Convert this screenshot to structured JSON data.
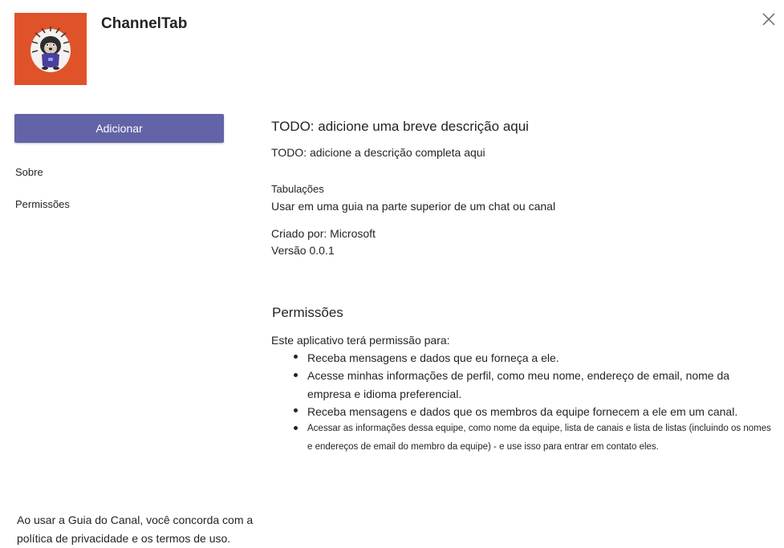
{
  "app": {
    "name": "ChannelTab",
    "add_button": "Adicionar",
    "nav": [
      "Sobre",
      "Permissões"
    ],
    "footer": "Ao usar a Guia do Canal, você concorda com a política de privacidade e os termos de uso."
  },
  "details": {
    "short_description": "TODO: adicione uma breve descrição aqui",
    "full_description": "TODO: adicione a descrição completa aqui",
    "capability_label": "Tabulações",
    "capability_value": "Usar em uma guia na parte superior de um chat ou canal",
    "created_by": "Criado por: Microsoft",
    "version": "Versão 0.0.1"
  },
  "permissions": {
    "title": "Permissões",
    "intro": "Este aplicativo terá permissão para:",
    "items": [
      "Receba mensagens e dados que eu forneça a ele.",
      "Acesse minhas informações de perfil, como meu nome, endereço de email, nome da empresa e idioma preferencial.",
      "Receba mensagens e dados que os membros da equipe fornecem a ele em um canal.",
      "Acessar as informações dessa equipe, como nome da equipe, lista de canais e lista de listas (incluindo os nomes e endereços de email do membro da equipe) - e use isso para entrar em contato eles."
    ]
  },
  "icons": {
    "logo": "porcupine-mascot-icon",
    "close": "close-icon"
  },
  "colors": {
    "logo_bg": "#e0522a",
    "button_bg": "#6264a7",
    "button_text": "#ffffff",
    "text": "#252423"
  }
}
